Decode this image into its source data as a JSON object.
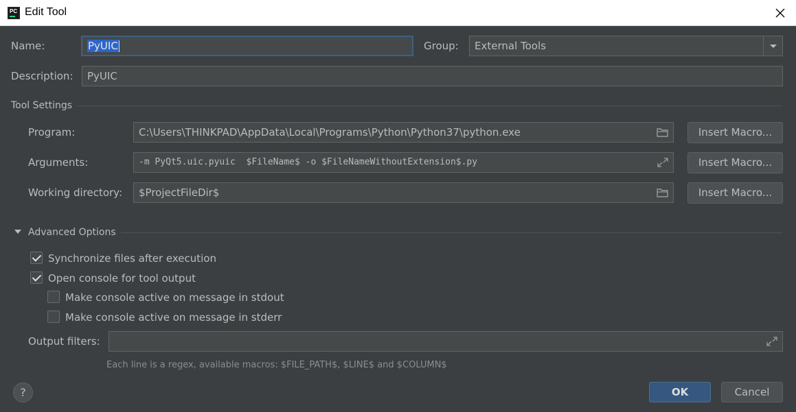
{
  "window": {
    "title": "Edit Tool"
  },
  "form": {
    "name_label": "Name:",
    "name_value": "PyUIC",
    "group_label": "Group:",
    "group_value": "External Tools",
    "description_label": "Description:",
    "description_value": "PyUIC"
  },
  "tool_settings": {
    "section_label": "Tool Settings",
    "program_label": "Program:",
    "program_value": "C:\\Users\\THINKPAD\\AppData\\Local\\Programs\\Python\\Python37\\python.exe",
    "arguments_label": "Arguments:",
    "arguments_value": "-m PyQt5.uic.pyuic  $FileName$ -o $FileNameWithoutExtension$.py",
    "working_dir_label": "Working directory:",
    "working_dir_value": "$ProjectFileDir$",
    "insert_macro_label": "Insert Macro..."
  },
  "advanced": {
    "section_label": "Advanced Options",
    "options": [
      {
        "label": "Synchronize files after execution",
        "checked": true
      },
      {
        "label": "Open console for tool output",
        "checked": true
      },
      {
        "label": "Make console active on message in stdout",
        "checked": false
      },
      {
        "label": "Make console active on message in stderr",
        "checked": false
      }
    ],
    "output_filters_label": "Output filters:",
    "output_filters_value": "",
    "hint": "Each line is a regex, available macros: $FILE_PATH$, $LINE$ and $COLUMN$"
  },
  "footer": {
    "help_label": "?",
    "ok_label": "OK",
    "cancel_label": "Cancel"
  },
  "icons": {
    "app": "pycharm-icon",
    "close": "close-icon",
    "dropdown": "chevron-down-icon",
    "folder": "folder-icon",
    "expand": "expand-icon",
    "collapse": "triangle-down-icon"
  }
}
